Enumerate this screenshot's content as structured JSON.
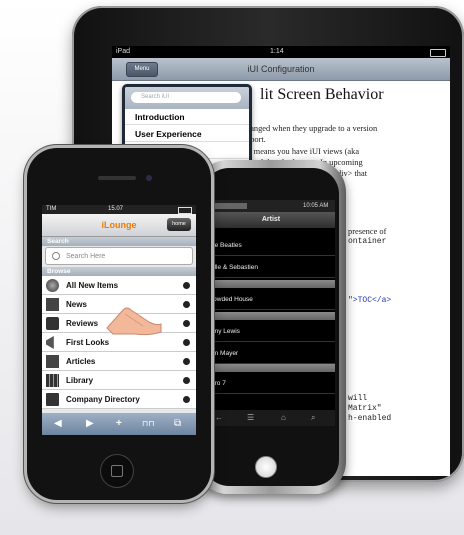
{
  "ipad": {
    "status": {
      "carrier": "iPad",
      "time": "1:14"
    },
    "nav": {
      "title": "iUI Configuration",
      "menu_button": "Menu"
    },
    "heading": "lit Screen Behavior",
    "body_lines": [
      "hanged when they upgrade to a version",
      "pport.",
      "is means you have iUI views (aka",
      "en of the <body> tag. In upcoming",
      "nder an iUI <div> that"
    ],
    "lower_lines": [
      "presence of",
      "ontainer",
      "\">TOC</a>",
      "will",
      "Matrix\"",
      "h-enabled"
    ],
    "popover": {
      "search_placeholder": "Search iUI",
      "items": [
        "Introduction",
        "User Experience",
        "ition"
      ]
    }
  },
  "android": {
    "status_time": "10:05 AM",
    "title": "Artist",
    "rows": [
      "he Beatles",
      "elle & Sebastien",
      "rowded House",
      "nny Lewis",
      "hn Mayer",
      "ero 7"
    ]
  },
  "iphone": {
    "status": {
      "carrier": "TIM",
      "time": "15.07"
    },
    "title": "iLounge",
    "home_button": "home",
    "search_section": "Search",
    "search_placeholder": "Search Here",
    "browse_section": "Browse",
    "items": [
      {
        "label": "All New Items",
        "icon": "globe-icon"
      },
      {
        "label": "News",
        "icon": "news-icon"
      },
      {
        "label": "Reviews",
        "icon": "reviews-icon"
      },
      {
        "label": "First Looks",
        "icon": "megaphone-icon"
      },
      {
        "label": "Articles",
        "icon": "articles-icon"
      },
      {
        "label": "Library",
        "icon": "library-icon"
      },
      {
        "label": "Company Directory",
        "icon": "directory-icon"
      }
    ],
    "toolbar": [
      "◀",
      "▶",
      "+",
      "⊓⊓",
      "⧉"
    ]
  },
  "colors": {
    "accent": "#f07a00",
    "nav_blue": "#8d9aa9",
    "toolbar_blue": "#6d84a0"
  }
}
